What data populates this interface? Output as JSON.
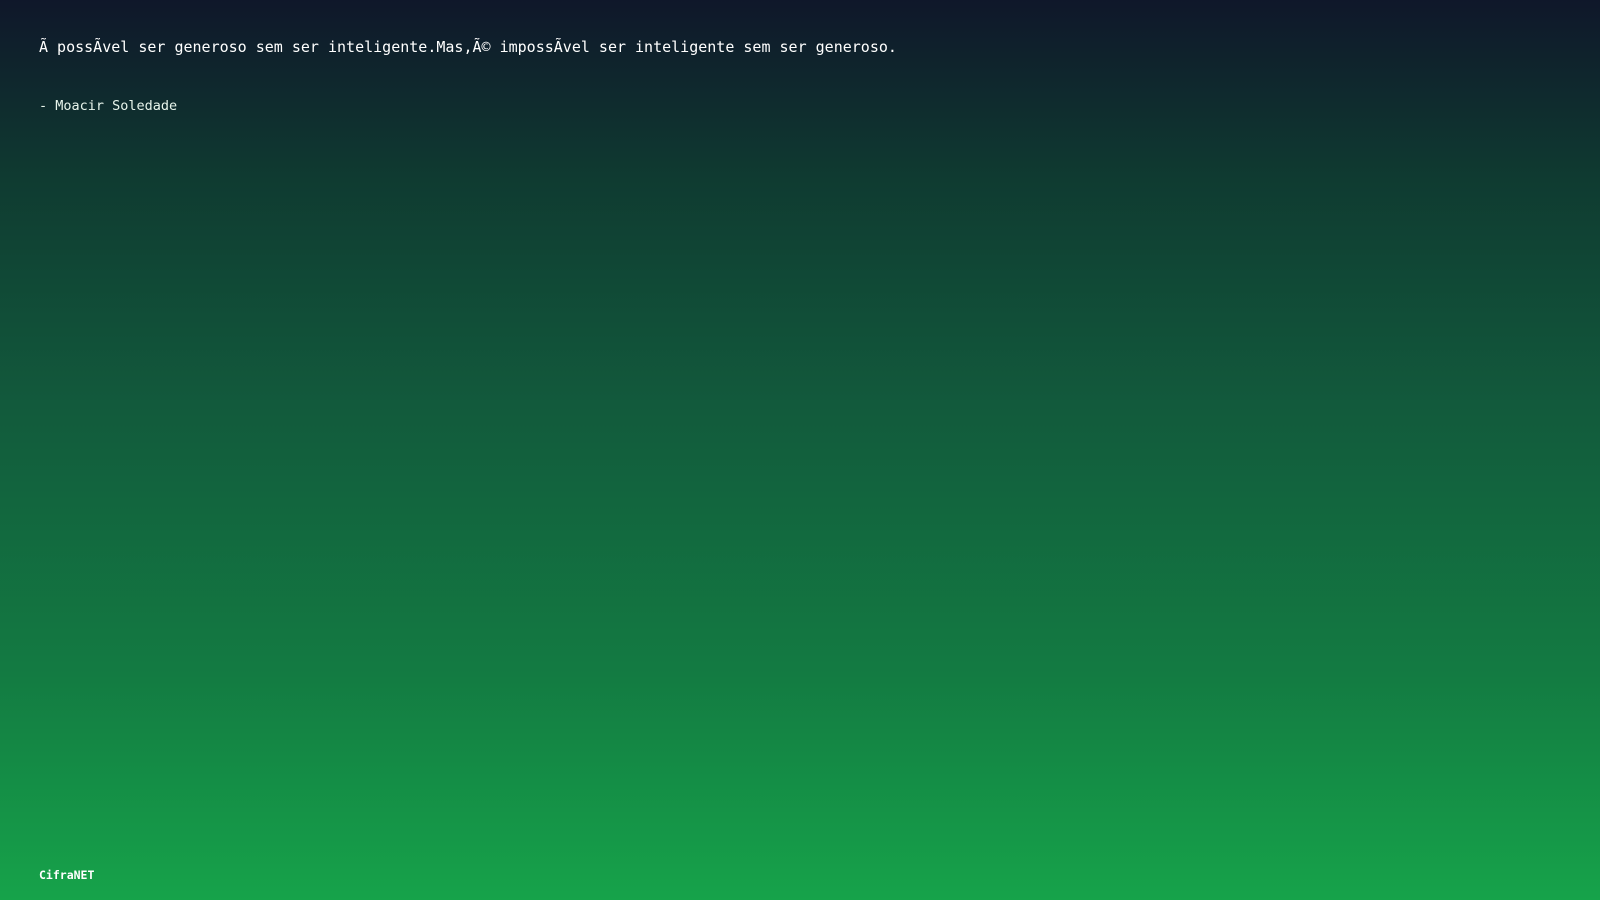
{
  "quote": {
    "text": "Ã  possÃ­vel ser generoso sem ser inteligente.Mas,Ã© impossÃ­vel ser inteligente sem ser generoso.",
    "author": "- Moacir Soledade"
  },
  "footer": {
    "brand": "CifraNET"
  },
  "colors": {
    "gradient_top": "#0f172a",
    "gradient_bottom": "#16a34a",
    "text": "#ffffff"
  }
}
